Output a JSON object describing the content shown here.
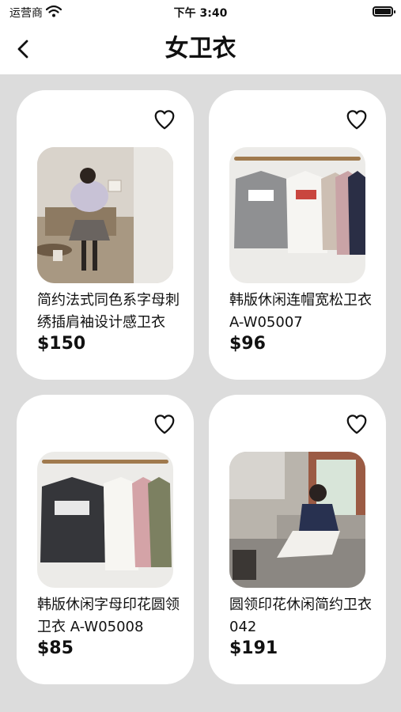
{
  "status": {
    "carrier": "运营商",
    "time": "下午 3:40"
  },
  "nav": {
    "title": "女卫衣"
  },
  "products": [
    {
      "name": "简约法式同色系字母刺绣插肩袖设计感卫衣",
      "price": "$150"
    },
    {
      "name": "韩版休闲连帽宽松卫衣 A-W05007",
      "price": "$96"
    },
    {
      "name": "韩版休闲字母印花圆领卫衣 A-W05008",
      "price": "$85"
    },
    {
      "name": "圆领印花休闲简约卫衣 042",
      "price": "$191"
    }
  ]
}
